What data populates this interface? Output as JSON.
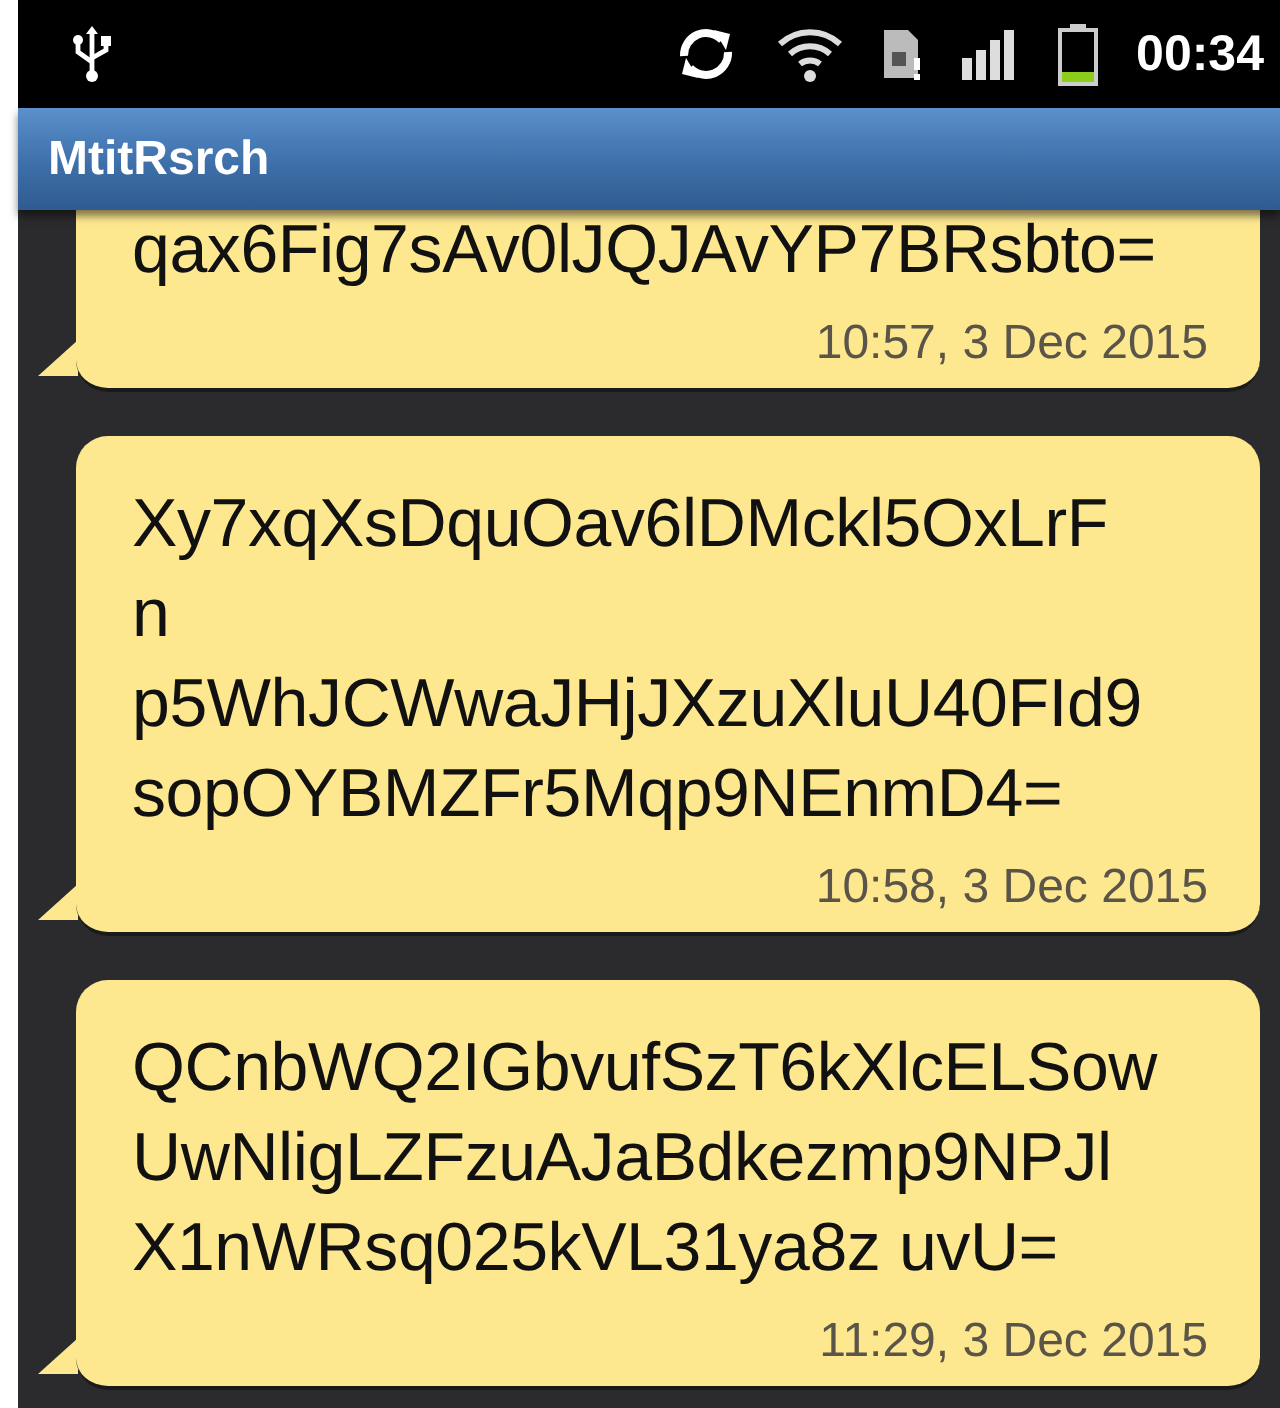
{
  "status_bar": {
    "time": "00:34"
  },
  "app_bar": {
    "title": "MtitRsrch"
  },
  "messages": [
    {
      "text": "qax6Fig7sAv0lJQJAvYP7BRsbto=",
      "time": "10:57, 3 Dec 2015"
    },
    {
      "text": "Xy7xqXsDquOav6lDMckl5OxLrF\nn\np5WhJCWwaJHjJXzuXluU40FId9\nsopOYBMZFr5Mqp9NEnmD4=",
      "time": "10:58, 3 Dec 2015"
    },
    {
      "text": "QCnbWQ2IGbvufSzT6kXlcELSow\nUwNligLZFzuAJaBdkezmp9NPJl\nX1nWRsq025kVL31ya8z uvU=",
      "time": "11:29, 3 Dec 2015"
    }
  ]
}
